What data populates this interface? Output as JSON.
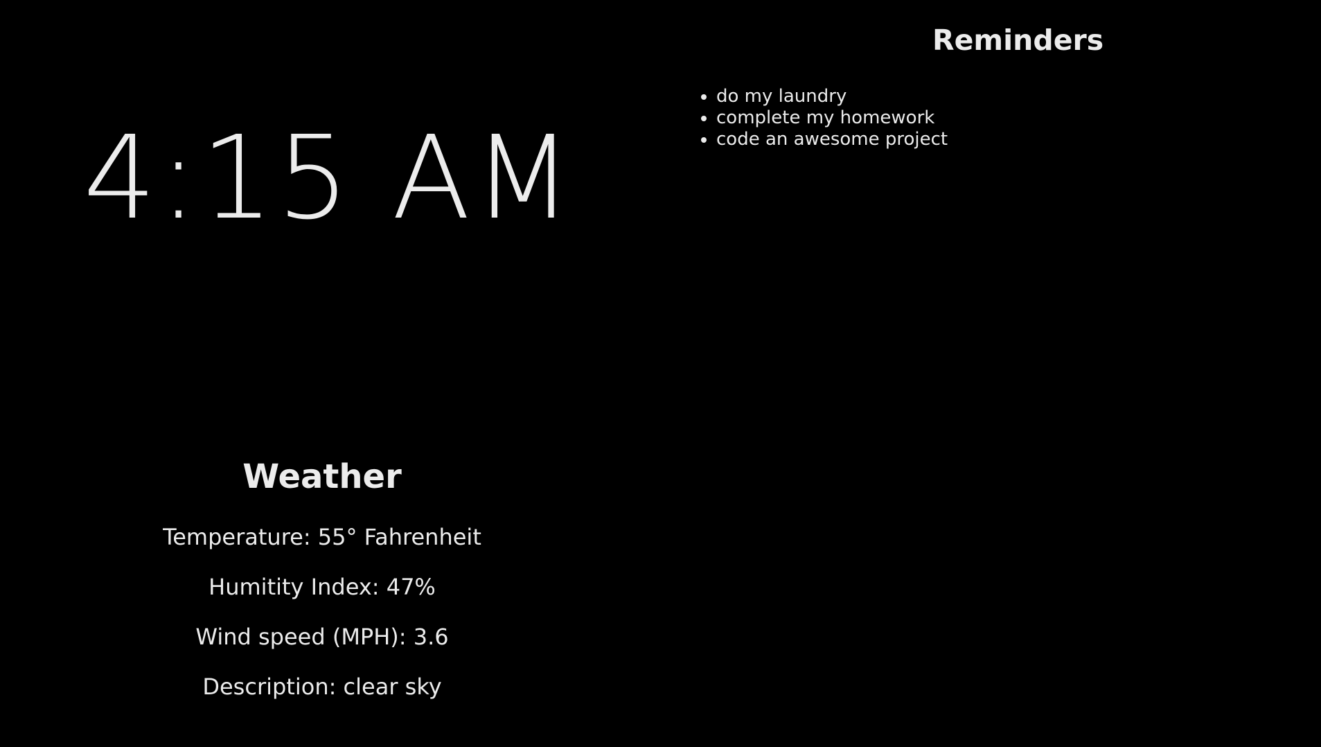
{
  "clock": {
    "time": "4:15 AM"
  },
  "reminders": {
    "title": "Reminders",
    "items": [
      "do my laundry",
      "complete my homework",
      "code an awesome project"
    ]
  },
  "weather": {
    "title": "Weather",
    "temperature": "Temperature: 55° Fahrenheit",
    "humidity": "Humitity Index: 47%",
    "wind": "Wind speed (MPH): 3.6",
    "description": "Description: clear sky"
  },
  "colors": {
    "background": "#000000",
    "text": "#ececec"
  }
}
